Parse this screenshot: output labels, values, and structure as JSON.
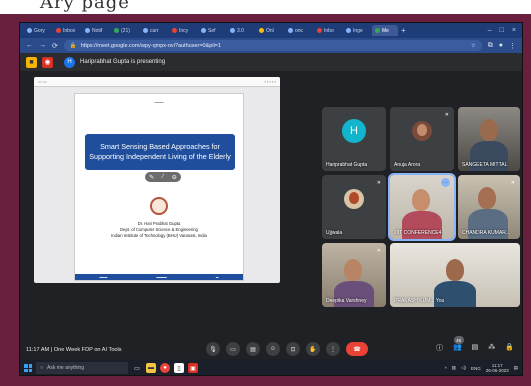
{
  "top_strip_text": "Ary page",
  "browser": {
    "tabs": [
      {
        "label": "Gory"
      },
      {
        "label": "Inbox"
      },
      {
        "label": "Notif"
      },
      {
        "label": "(21)"
      },
      {
        "label": "curr"
      },
      {
        "label": "Incy"
      },
      {
        "label": "Sef"
      },
      {
        "label": "3.0"
      },
      {
        "label": "Onl"
      },
      {
        "label": "onc"
      },
      {
        "label": "Inbo"
      },
      {
        "label": "Inge"
      },
      {
        "label": "Me"
      }
    ],
    "url": "https://meet.google.com/wpy-qmpx-ovi?authuser=0&pli=1",
    "window_controls": [
      "–",
      "□",
      "×"
    ]
  },
  "meet": {
    "presenter_initial": "H",
    "presenting_text": "Hariprabhat Gupta is presenting",
    "slide": {
      "title_line1": "Smart Sensing Based Approaches for",
      "title_line2": "Supporting Independent Living of the Elderly",
      "author_line1": "Dr. Hari Prabhat Gupta",
      "author_line2": "Dept. of Computer Science & Engineering",
      "author_line3": "Indian Institute of Technology (BHU) Varanasi, India"
    },
    "participants": [
      {
        "name": "Hariprabhat Gupta",
        "initial": "H"
      },
      {
        "name": "Anuja Arora"
      },
      {
        "name": "SANGEETA MITTAL"
      },
      {
        "name": "Ujjwala"
      },
      {
        "name": "JIIT CONFERENCE4"
      },
      {
        "name": "CHANDRA KUMAR..."
      },
      {
        "name": "Deepika Varshney"
      },
      {
        "name": "PRAKASH KUM... You"
      }
    ],
    "meeting_time": "11:17 AM",
    "meeting_name": "One Week FDP on AI Tools",
    "participant_count": "45"
  },
  "taskbar": {
    "search_placeholder": "Ask me anything",
    "lang": "ENG",
    "time": "11:17",
    "date": "26-06-2023"
  },
  "colors": {
    "background_border": "#6b1f3f",
    "meet_bg": "#202124",
    "end_call": "#ea4335",
    "slide_title_bg": "#1f4e9c"
  }
}
